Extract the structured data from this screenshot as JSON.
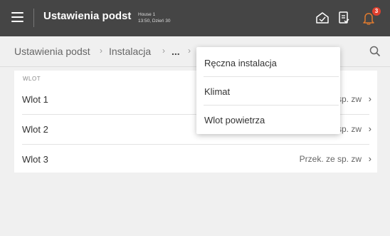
{
  "header": {
    "title": "Ustawienia podst",
    "house_name": "House 1",
    "house_time": "13:50, Dzień 30",
    "notification_count": "3"
  },
  "breadcrumb": {
    "items": [
      "Ustawienia podst",
      "Instalacja",
      "...",
      ""
    ],
    "separator": "›"
  },
  "section": {
    "label": "WLOT",
    "rows": [
      {
        "label": "Wlot 1",
        "value": "Przek. ze sp. zw"
      },
      {
        "label": "Wlot 2",
        "value": "Przek. ze sp. zw"
      },
      {
        "label": "Wlot 3",
        "value": "Przek. ze sp. zw"
      }
    ]
  },
  "dropdown": {
    "items": [
      "Ręczna instalacja",
      "Klimat",
      "Wlot powietrza"
    ]
  },
  "icons": {
    "menu": "hamburger-icon",
    "house": "house-status-icon",
    "report": "report-icon",
    "notifications": "bell-icon",
    "search": "search-icon",
    "chevron": "chevron-right-icon"
  },
  "colors": {
    "topbar": "#454545",
    "background": "#f0f0f0",
    "badge": "#e0402e"
  }
}
